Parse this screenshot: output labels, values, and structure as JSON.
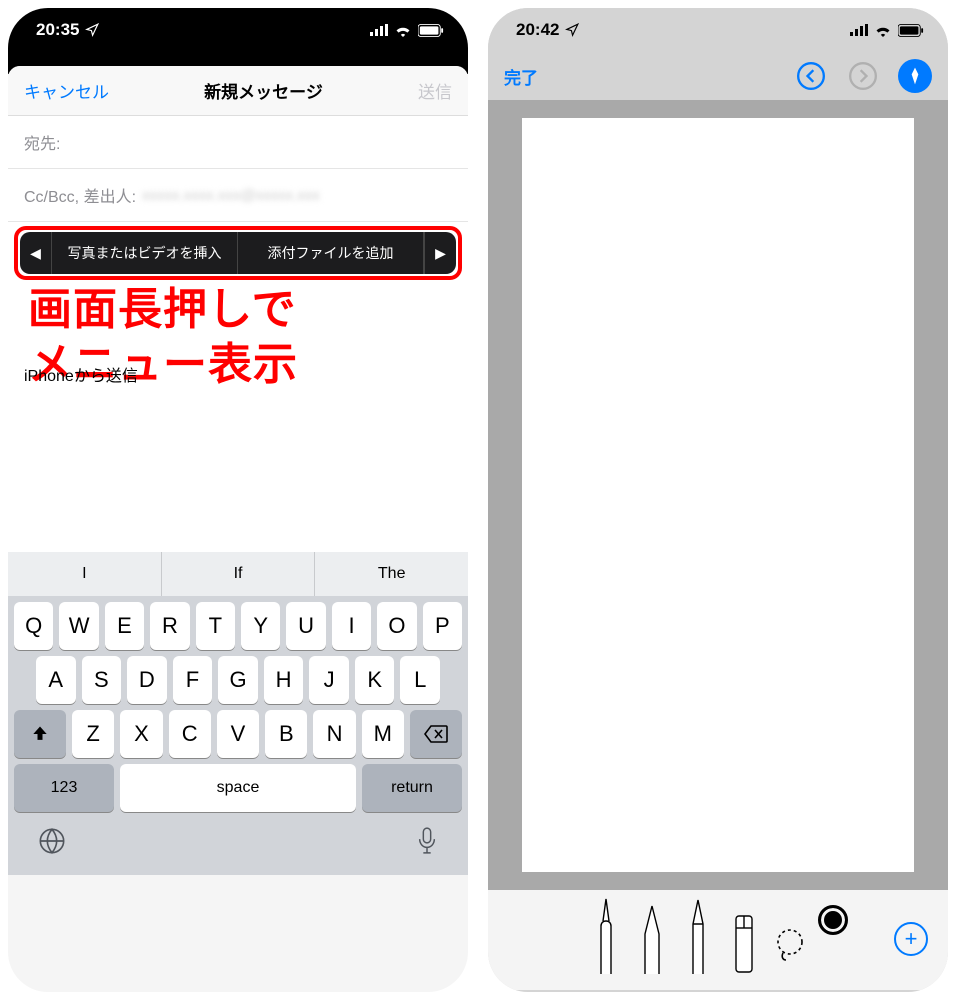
{
  "left": {
    "status": {
      "time": "20:35",
      "loc_icon": "location-icon",
      "signal": "signal-icon",
      "wifi": "wifi-icon",
      "battery": "battery-icon"
    },
    "nav": {
      "cancel": "キャンセル",
      "title": "新規メッセージ",
      "send": "送信"
    },
    "fields": {
      "to": "宛先:",
      "ccbcc": "Cc/Bcc, 差出人:",
      "from_blurred": "xxxxx.xxxx.xxx@xxxxx.xxx"
    },
    "popup": {
      "left_arrow": "◀",
      "item1": "写真またはビデオを挿入",
      "item2": "添付ファイルを追加",
      "right_arrow": "▶"
    },
    "annotation_line1": "画面長押しで",
    "annotation_line2": "メニュー表示",
    "signature": "iPhoneから送信",
    "suggest": [
      "I",
      "If",
      "The"
    ],
    "rows": {
      "r1": [
        "Q",
        "W",
        "E",
        "R",
        "T",
        "Y",
        "U",
        "I",
        "O",
        "P"
      ],
      "r2": [
        "A",
        "S",
        "D",
        "F",
        "G",
        "H",
        "J",
        "K",
        "L"
      ],
      "r3": [
        "Z",
        "X",
        "C",
        "V",
        "B",
        "N",
        "M"
      ]
    },
    "bottom": {
      "num": "123",
      "space": "space",
      "ret": "return"
    }
  },
  "right": {
    "status": {
      "time": "20:42"
    },
    "toolbar": {
      "done": "完了"
    },
    "tools": [
      "marker",
      "highlighter",
      "pencil",
      "eraser",
      "lasso"
    ]
  }
}
